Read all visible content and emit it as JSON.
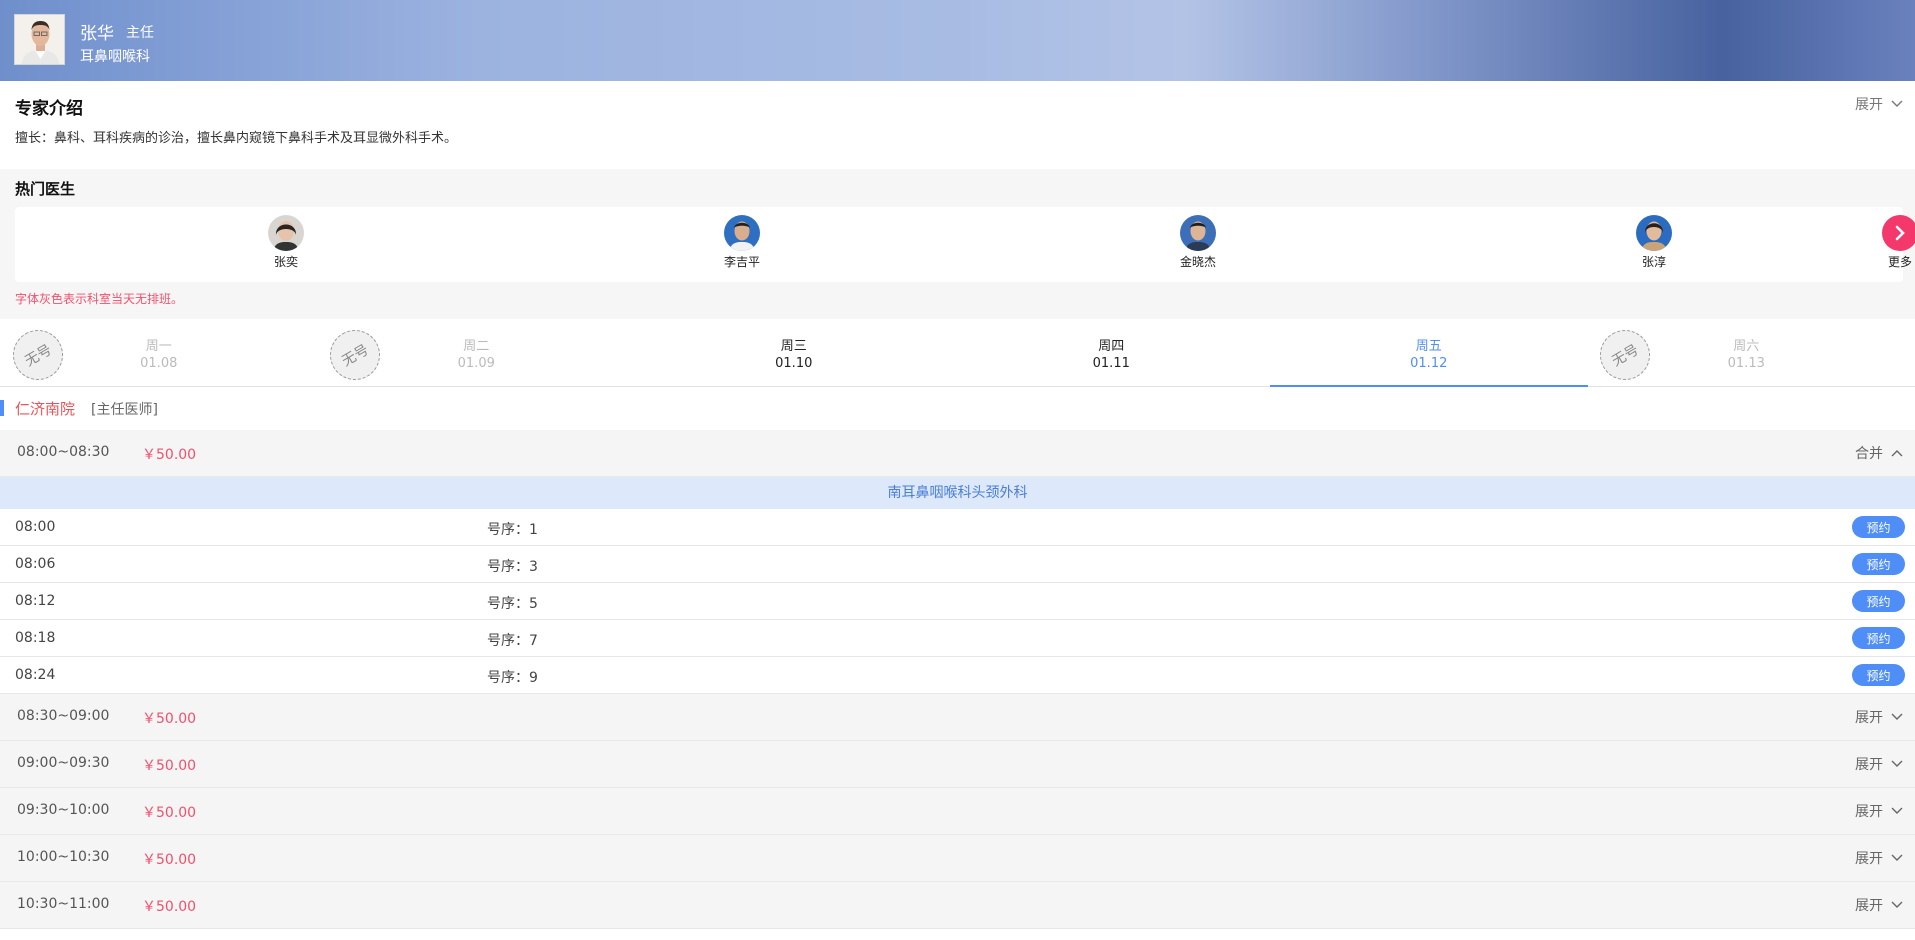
{
  "header": {
    "doctor_name": "张华",
    "doctor_title": "主任",
    "department": "耳鼻咽喉科"
  },
  "intro": {
    "title": "专家介绍",
    "toggle": "展开",
    "text": "擅长：鼻科、耳科疾病的诊治，擅长鼻内窥镜下鼻科手术及耳显微外科手术。"
  },
  "hot_doctors": {
    "title": "热门医生",
    "doctors": [
      "张奕",
      "李吉平",
      "金晓杰",
      "张淳"
    ],
    "more_label": "更多",
    "hint": "字体灰色表示科室当天无排班。"
  },
  "dates": {
    "no_slot_label": "无号",
    "days": [
      {
        "weekday": "周一",
        "date": "01.08",
        "state": "off"
      },
      {
        "weekday": "周二",
        "date": "01.09",
        "state": "off"
      },
      {
        "weekday": "周三",
        "date": "01.10",
        "state": "on"
      },
      {
        "weekday": "周四",
        "date": "01.11",
        "state": "on"
      },
      {
        "weekday": "周五",
        "date": "01.12",
        "state": "selected"
      },
      {
        "weekday": "周六",
        "date": "01.13",
        "state": "off"
      }
    ]
  },
  "hospital": {
    "name": "仁济南院",
    "rank": "[主任医师]"
  },
  "slots": [
    {
      "time": "08:00~08:30",
      "price": "￥50.00",
      "toggle": "合并",
      "expanded": true
    },
    {
      "time": "08:30~09:00",
      "price": "￥50.00",
      "toggle": "展开"
    },
    {
      "time": "09:00~09:30",
      "price": "￥50.00",
      "toggle": "展开"
    },
    {
      "time": "09:30~10:00",
      "price": "￥50.00",
      "toggle": "展开"
    },
    {
      "time": "10:00~10:30",
      "price": "￥50.00",
      "toggle": "展开"
    },
    {
      "time": "10:30~11:00",
      "price": "￥50.00",
      "toggle": "展开"
    }
  ],
  "expanded_slot": {
    "department": "南耳鼻咽喉科头颈外科",
    "rows": [
      {
        "time": "08:00",
        "number": "号序：1",
        "action": "预约"
      },
      {
        "time": "08:06",
        "number": "号序：3",
        "action": "预约"
      },
      {
        "time": "08:12",
        "number": "号序：5",
        "action": "预约"
      },
      {
        "time": "08:18",
        "number": "号序：7",
        "action": "预约"
      },
      {
        "time": "08:24",
        "number": "号序：9",
        "action": "预约"
      }
    ]
  },
  "colors": {
    "accent_blue": "#4f8ef7",
    "price_red": "#f0506e",
    "more_button": "#f5386b"
  }
}
